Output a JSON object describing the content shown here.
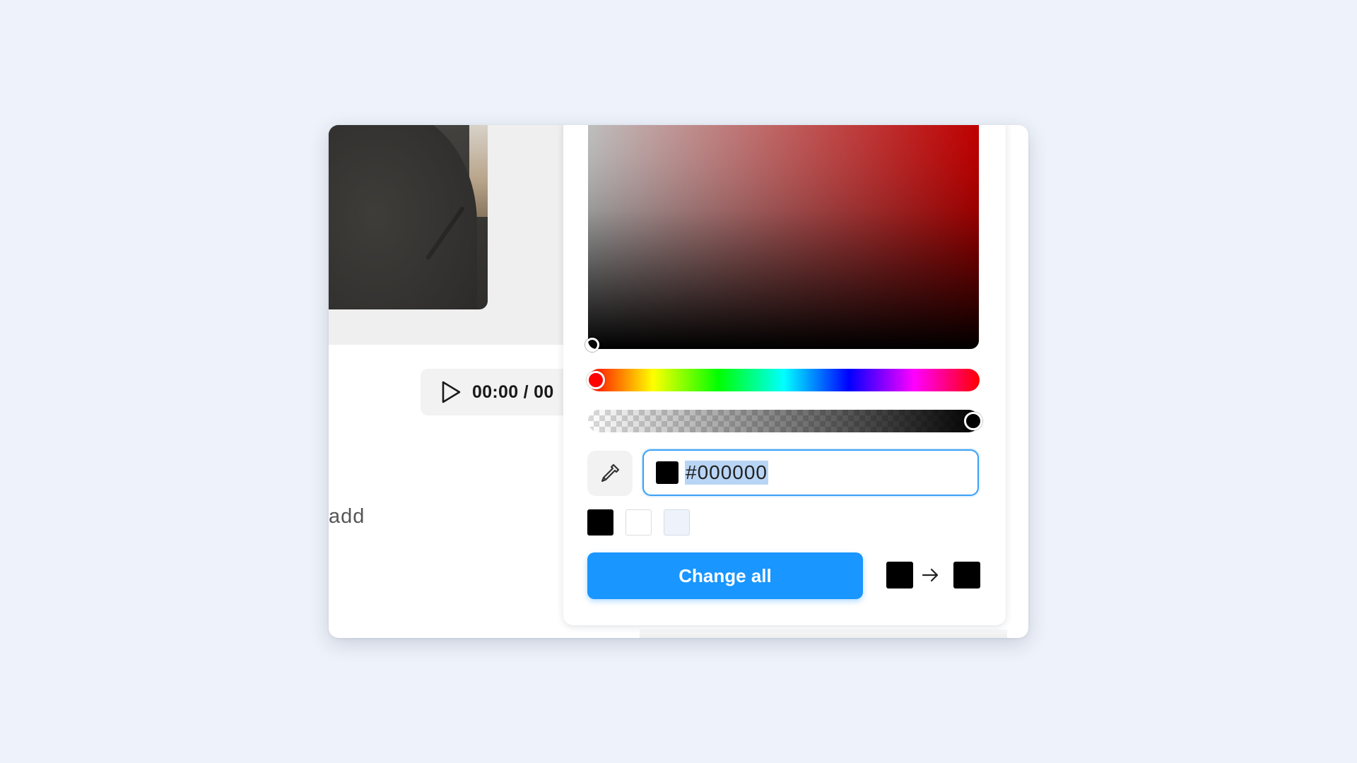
{
  "player": {
    "time": "00:00 / 00",
    "play_icon": "play-icon"
  },
  "left_text": "add",
  "picker": {
    "saturation_value": 0,
    "brightness": 0,
    "hue_degrees": 0,
    "alpha_percent": 100,
    "hex_value": "#000000",
    "current_color": "#000000",
    "eyedropper_icon": "eyedropper-icon",
    "swatches": [
      "#000000",
      "#ffffff",
      "#eef2fa"
    ],
    "change_all_label": "Change all",
    "swap_from_color": "#000000",
    "swap_to_color": "#000000",
    "arrow_icon": "arrow-right-icon"
  },
  "colors": {
    "accent": "#1996ff",
    "focus_border": "#3aa0f5",
    "page_background": "#eef2fa"
  }
}
